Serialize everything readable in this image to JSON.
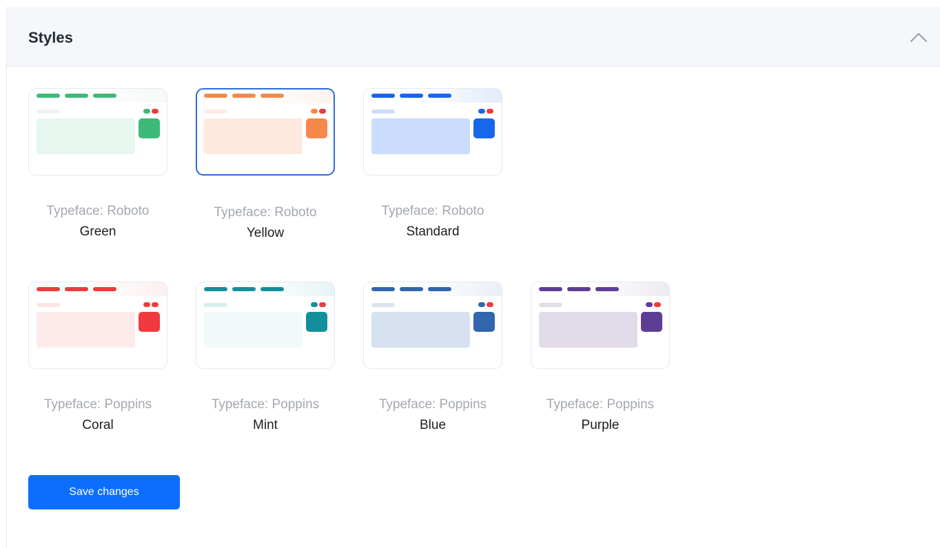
{
  "section": {
    "title": "Styles",
    "collapse_icon": "chevron-up-icon"
  },
  "styles": [
    {
      "typeface": "Typeface: Roboto",
      "name": "Green",
      "accent": "#3dba78",
      "tint": "#e7f6ee",
      "sub": "#eef5f1",
      "selected": false
    },
    {
      "typeface": "Typeface: Roboto",
      "name": "Yellow",
      "accent": "#f5894a",
      "tint": "#fde9dd",
      "sub": "#fdece2",
      "selected": true
    },
    {
      "typeface": "Typeface: Roboto",
      "name": "Standard",
      "accent": "#1866ea",
      "tint": "#c9dcfb",
      "sub": "#cfdef7",
      "selected": false
    },
    {
      "typeface": "Typeface: Poppins",
      "name": "Coral",
      "accent": "#ef3b3d",
      "tint": "#fdeaea",
      "sub": "#fbe6e6",
      "selected": false
    },
    {
      "typeface": "Typeface: Poppins",
      "name": "Mint",
      "accent": "#138f9c",
      "tint": "#f2f9fa",
      "sub": "#d6edf0",
      "selected": false
    },
    {
      "typeface": "Typeface: Poppins",
      "name": "Blue",
      "accent": "#3266ad",
      "tint": "#d7e1ef",
      "sub": "#dde5f1",
      "selected": false
    },
    {
      "typeface": "Typeface: Poppins",
      "name": "Purple",
      "accent": "#5e3e95",
      "tint": "#e2dbe9",
      "sub": "#e3dcea",
      "selected": false
    }
  ],
  "status_red": "#ef3b3d",
  "save_button": {
    "label": "Save changes",
    "color": "#0d6efd"
  }
}
